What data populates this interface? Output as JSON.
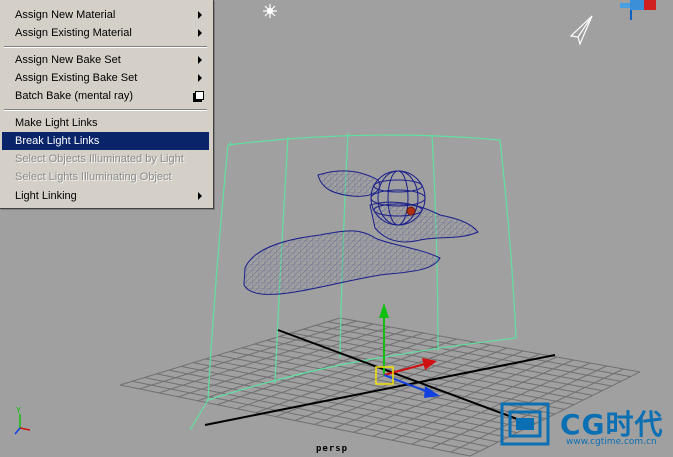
{
  "menu": {
    "items": [
      {
        "label": "Assign New Material",
        "submenu": true
      },
      {
        "label": "Assign Existing Material",
        "submenu": true
      },
      {
        "label": "Assign New Bake Set",
        "submenu": true
      },
      {
        "label": "Assign Existing Bake Set",
        "submenu": true
      },
      {
        "label": "Batch Bake (mental ray)",
        "option_box": true
      },
      {
        "label": "Make Light Links"
      },
      {
        "label": "Break Light Links",
        "highlighted": true
      },
      {
        "label": "Select Objects Illuminated by Light",
        "disabled": true
      },
      {
        "label": "Select Lights Illuminating Object",
        "disabled": true
      },
      {
        "label": "Light Linking",
        "submenu": true
      }
    ]
  },
  "viewport": {
    "camera_label": "persp",
    "background_color": "#a0a0a0",
    "grid_color": "#6e6e6e",
    "wireframe_color": "#1a1f8a",
    "light_manip_color": "#5fe0a0",
    "axis_colors": {
      "x": "#d01010",
      "y": "#10c010",
      "z": "#1040e0"
    }
  },
  "watermark": {
    "logo_text": "CG时代",
    "url": "www.cgtime.com.cn"
  }
}
